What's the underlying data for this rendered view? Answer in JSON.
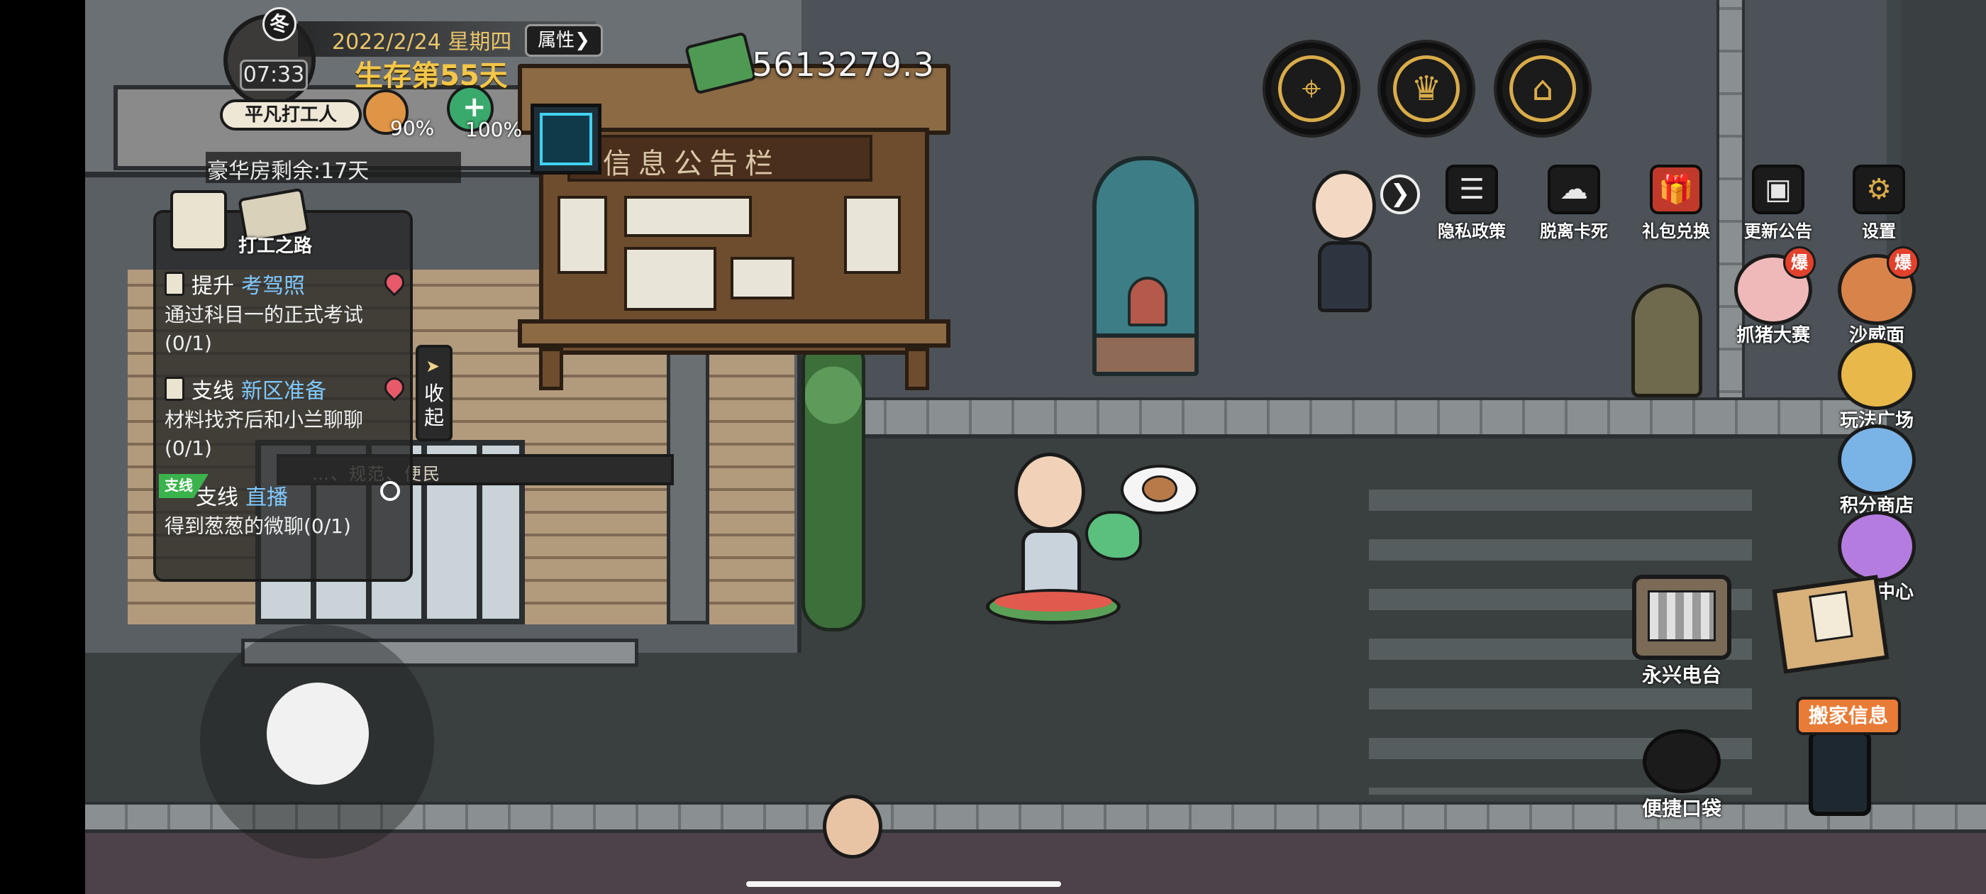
{
  "hud": {
    "season": "冬",
    "time": "07:33",
    "date": "2022/2/24 星期四",
    "attributes_label": "属性",
    "attributes_arrow": "❯",
    "survival_days": "生存第55天",
    "player_title": "平凡打工人",
    "hunger_percent": "90%",
    "health_percent": "100%",
    "luxury_room_remaining": "豪华房剩余:17天",
    "money": "5613279.3"
  },
  "quest_panel": {
    "tab_work_label": "打工之路",
    "quests": [
      {
        "type": "提升",
        "name": "考驾照",
        "desc": "通过科目一的正式考试(0/1)"
      },
      {
        "type": "支线",
        "name": "新区准备",
        "desc": "材料找齐后和小兰聊聊(0/1)"
      },
      {
        "type": "支线",
        "name": "直播",
        "desc": "得到葱葱的微聊(0/1)",
        "tag": "支线"
      }
    ],
    "collapse_label": "收起"
  },
  "world": {
    "board_title": "信息公告栏",
    "building_banner": "…、规范、便民"
  },
  "top_buttons": [
    {
      "icon": "map-pin-icon"
    },
    {
      "icon": "trophy-icon"
    },
    {
      "icon": "backpack-icon"
    }
  ],
  "menu": {
    "arrow": "❯",
    "items": [
      {
        "label": "隐私政策",
        "icon": "document-icon"
      },
      {
        "label": "脱离卡死",
        "icon": "cloud-icon"
      },
      {
        "label": "礼包兑换",
        "icon": "gift-icon"
      },
      {
        "label": "更新公告",
        "icon": "notice-icon"
      },
      {
        "label": "设置",
        "icon": "gear-icon"
      }
    ]
  },
  "events": [
    {
      "label": "抓猪大赛",
      "hot": "爆",
      "color": "#f0b9b9"
    },
    {
      "label": "沙威面",
      "hot": "爆",
      "color": "#d8834a"
    },
    {
      "label": "玩法广场",
      "color": "#e9b84a"
    },
    {
      "label": "积分商店",
      "color": "#7ab3e6"
    },
    {
      "label": "活动中心",
      "color": "#b57ce0"
    }
  ],
  "bottom_right": {
    "radio_label": "永兴电台",
    "pocket_label": "便捷口袋",
    "move_info_label": "搬家信息"
  }
}
